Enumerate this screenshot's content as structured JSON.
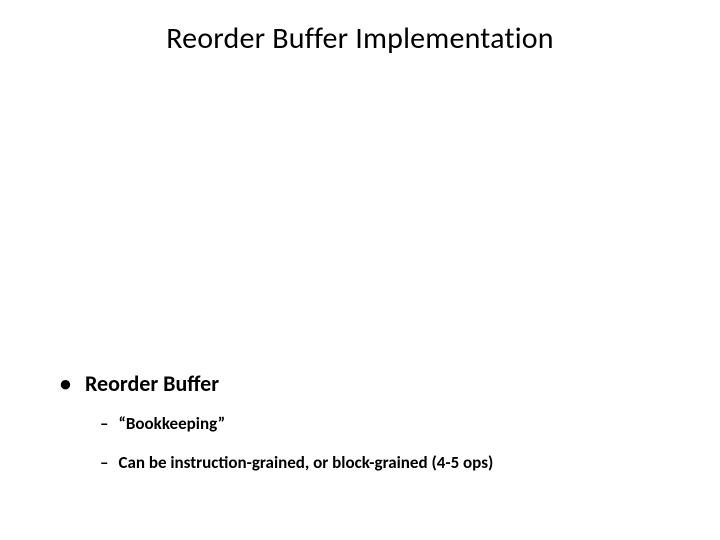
{
  "title": "Reorder Buffer Implementation",
  "bullets": {
    "lvl1_label": "Reorder Buffer",
    "sub1": "“Bookkeeping”",
    "sub2": "Can be instruction-grained, or block-grained (4-5 ops)"
  },
  "glyphs": {
    "bullet": "•",
    "dash": "–"
  }
}
